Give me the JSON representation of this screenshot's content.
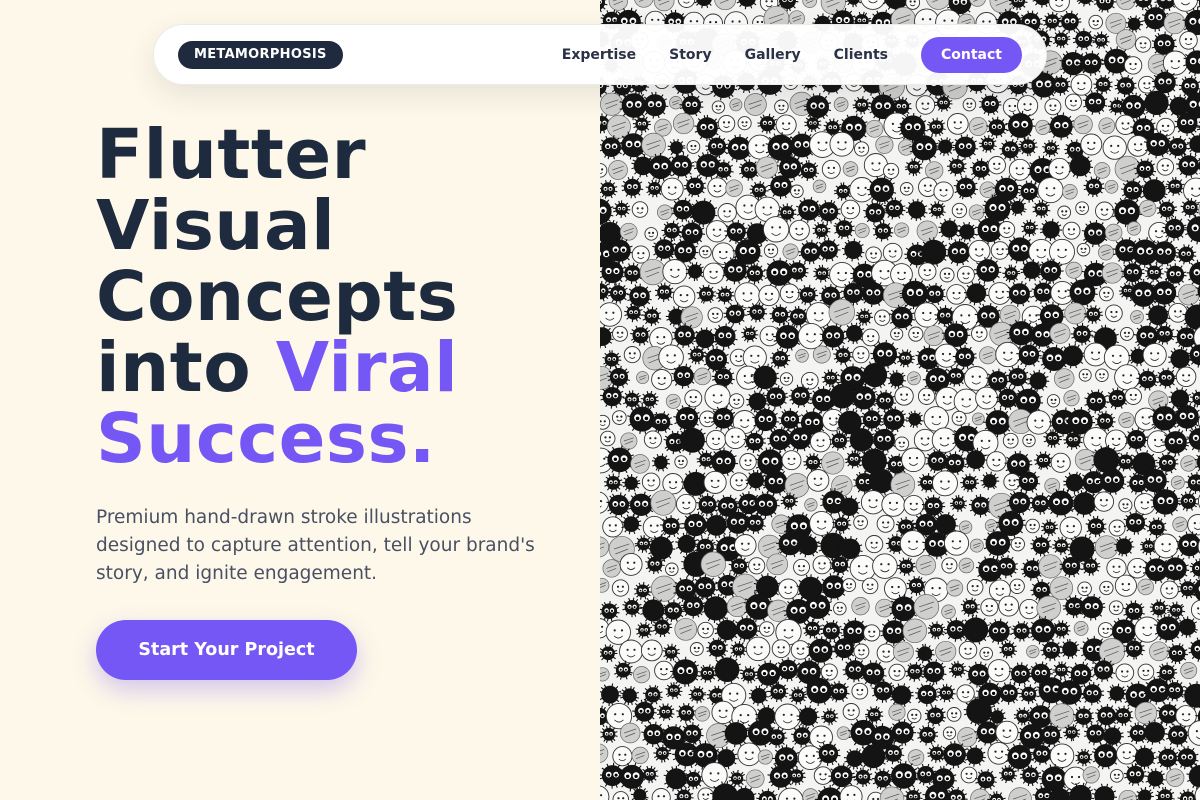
{
  "nav": {
    "brand": "METAMORPHOSIS",
    "links": [
      "Expertise",
      "Story",
      "Gallery",
      "Clients"
    ],
    "contact": "Contact"
  },
  "hero": {
    "title_line1": "Flutter",
    "title_line2": "Visual",
    "title_line3": "Concepts",
    "title_line4_plain": "into ",
    "title_line4_accent": "Viral",
    "title_line5_accent": "Success.",
    "subtitle": "Premium hand-drawn stroke illustrations designed to capture attention, tell your brand's story, and ignite engagement.",
    "cta": "Start Your Project"
  },
  "artwork": {
    "description_icon": "hand-drawn-soot-sprite-doodles-icon"
  },
  "colors": {
    "background": "#fdf8e9",
    "accent": "#7457f5",
    "dark": "#1e2a3e",
    "brand_pill": "#1f2a3f",
    "body_text": "#4a5063"
  }
}
